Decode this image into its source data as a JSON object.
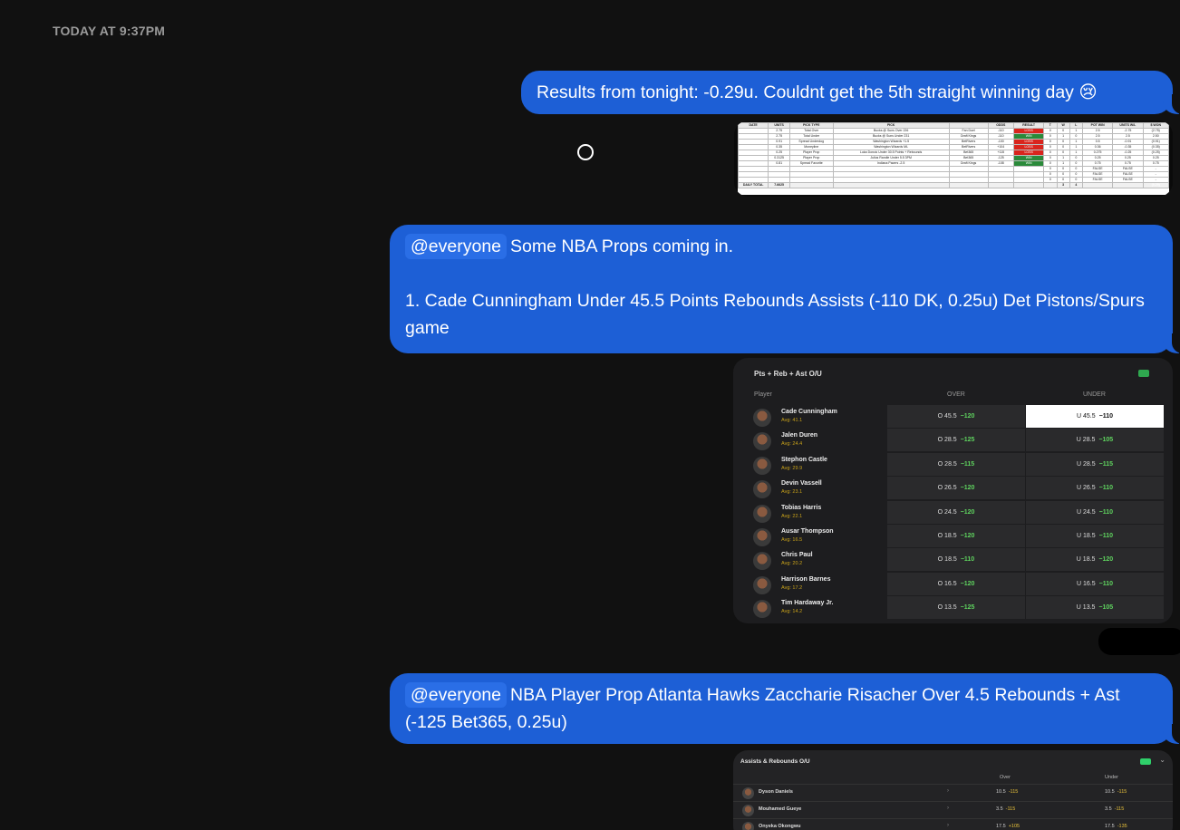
{
  "timestamp": "TODAY AT 9:37PM",
  "messages": [
    {
      "text": "Results from tonight: -0.29u. Couldnt get the 5th straight winning day 😢"
    },
    {
      "mention": "@everyone",
      "line1": "Some NBA Props coming in.",
      "line2": "1. Cade Cunningham Under 45.5 Points Rebounds Assists (-110 DK, 0.25u) Det Pistons/Spurs game"
    },
    {
      "mention": "@everyone",
      "text": "NBA Player Prop Atlanta Hawks Zaccharie Risacher Over 4.5 Rebounds + Ast (-125 Bet365, 0.25u)"
    }
  ],
  "sheet": {
    "headers": [
      "DATE",
      "UNITS",
      "PICK TYPE",
      "PICK",
      "",
      "ODDS",
      "RESULT",
      "T",
      "W",
      "L",
      "POT WIN",
      "UNITS W/L",
      "$ WON"
    ],
    "rows": [
      [
        "",
        "2.75",
        "Total Over",
        "Bucks @ Suns Over 226",
        "Fan Duel",
        "-110",
        "LOSS",
        "0",
        "0",
        "1",
        "2.5",
        "-2.75",
        "(2.75)"
      ],
      [
        "",
        "2.75",
        "Total Under",
        "Bucks @ Suns Under 231",
        "Draft Kings",
        "-110",
        "WIN",
        "0",
        "1",
        "0",
        "2.5",
        "2.5",
        "2.50"
      ],
      [
        "",
        "0.91",
        "Spread Underdog",
        "Washington Wizards +1.5",
        "BetRivers",
        "-100",
        "LOSS",
        "0",
        "0",
        "1",
        "0.5",
        "-0.91",
        "(0.91)"
      ],
      [
        "",
        "0.35",
        "Moneyline",
        "Washington Wizards ML",
        "BetRivers",
        "+104",
        "LOSS",
        "0",
        "0",
        "1",
        "0.36",
        "-0.35",
        "(0.35)"
      ],
      [
        "",
        "0.25",
        "Player Prop",
        "Luka Doncic Under 30.5 Points + Rebounds",
        "Bet365",
        "+115",
        "LOSS",
        "0",
        "0",
        "1",
        "0.275",
        "-0.25",
        "(0.25)"
      ],
      [
        "",
        "0.3125",
        "Player Prop",
        "Julius Randle Under 5.5 3PM",
        "Bet365",
        "-125",
        "WIN",
        "0",
        "1",
        "0",
        "0.25",
        "0.25",
        "0.25"
      ],
      [
        "",
        "0.81",
        "Spread Favorite",
        "Indiana Pacers -2.5",
        "Draft Kings",
        "-108",
        "WIN",
        "0",
        "1",
        "0",
        "0.75",
        "0.75",
        "0.75"
      ],
      [
        "",
        "",
        "",
        "",
        "",
        "",
        "",
        "0",
        "0",
        "0",
        "FALSE",
        "FALSE",
        "-"
      ],
      [
        "",
        "",
        "",
        "",
        "",
        "",
        "",
        "0",
        "0",
        "0",
        "FALSE",
        "FALSE",
        "-"
      ],
      [
        "",
        "",
        "",
        "",
        "",
        "",
        "",
        "0",
        "0",
        "0",
        "FALSE",
        "FALSE",
        "-"
      ]
    ],
    "total": [
      "DAILY TOTAL",
      "7.6625",
      "",
      "",
      "",
      "",
      "",
      "",
      "3",
      "4",
      "",
      "",
      "(0.29)"
    ]
  },
  "odds": {
    "title": "Pts + Reb + Ast O/U",
    "col_player": "Player",
    "col_over": "OVER",
    "col_under": "UNDER",
    "players": [
      {
        "name": "Cade Cunningham",
        "avg": "Avg: 41.1",
        "over": "O 45.5",
        "over_price": "−120",
        "under": "U 45.5",
        "under_price": "−110",
        "selected": "under"
      },
      {
        "name": "Jalen Duren",
        "avg": "Avg: 24.4",
        "over": "O 28.5",
        "over_price": "−125",
        "under": "U 28.5",
        "under_price": "−105"
      },
      {
        "name": "Stephon Castle",
        "avg": "Avg: 29.9",
        "over": "O 28.5",
        "over_price": "−115",
        "under": "U 28.5",
        "under_price": "−115"
      },
      {
        "name": "Devin Vassell",
        "avg": "Avg: 23.1",
        "over": "O 26.5",
        "over_price": "−120",
        "under": "U 26.5",
        "under_price": "−110"
      },
      {
        "name": "Tobias Harris",
        "avg": "Avg: 22.1",
        "over": "O 24.5",
        "over_price": "−120",
        "under": "U 24.5",
        "under_price": "−110"
      },
      {
        "name": "Ausar Thompson",
        "avg": "Avg: 16.5",
        "over": "O 18.5",
        "over_price": "−120",
        "under": "U 18.5",
        "under_price": "−110"
      },
      {
        "name": "Chris Paul",
        "avg": "Avg: 20.2",
        "over": "O 18.5",
        "over_price": "−110",
        "under": "U 18.5",
        "under_price": "−120"
      },
      {
        "name": "Harrison Barnes",
        "avg": "Avg: 17.2",
        "over": "O 16.5",
        "over_price": "−120",
        "under": "U 16.5",
        "under_price": "−110"
      },
      {
        "name": "Tim Hardaway Jr.",
        "avg": "Avg: 14.2",
        "over": "O 13.5",
        "over_price": "−125",
        "under": "U 13.5",
        "under_price": "−105"
      }
    ]
  },
  "odds2": {
    "title": "Assists & Rebounds O/U",
    "col_over": "Over",
    "col_under": "Under",
    "players": [
      {
        "name": "Dyson Daniels",
        "over": "10.5",
        "over_price": "-115",
        "under": "10.5",
        "under_price": "-115"
      },
      {
        "name": "Mouhamed Gueye",
        "over": "3.5",
        "over_price": "-115",
        "under": "3.5",
        "under_price": "-115"
      },
      {
        "name": "Onyeka Okongwu",
        "over": "17.5",
        "over_price": "+105",
        "under": "17.5",
        "under_price": "-135"
      }
    ]
  }
}
